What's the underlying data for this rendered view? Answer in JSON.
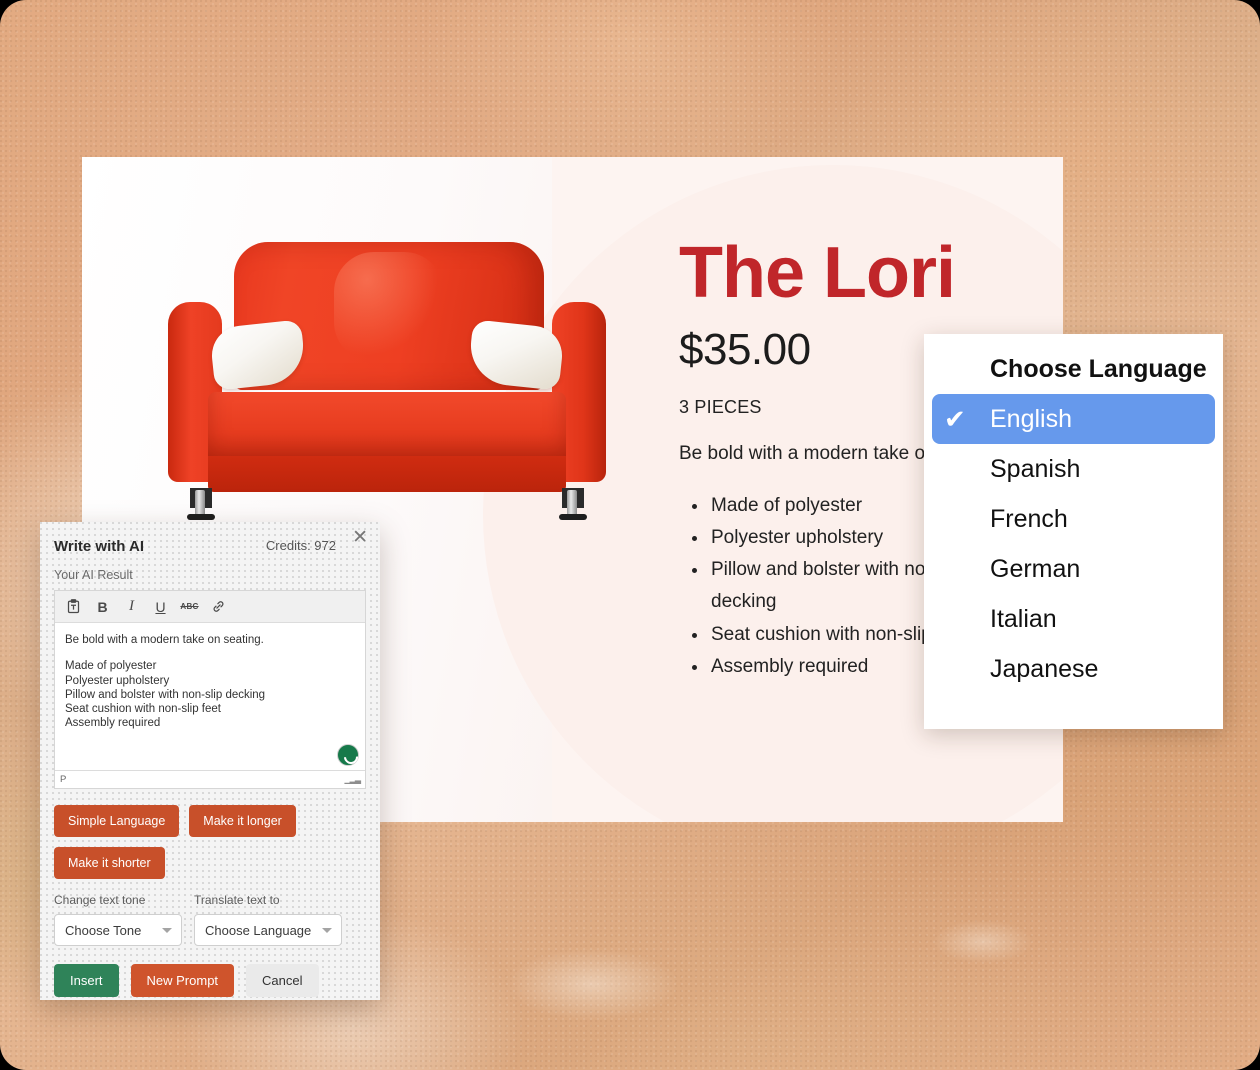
{
  "product": {
    "title": "The Lori",
    "price": "$35.00",
    "pieces": "3 PIECES",
    "description": "Be bold with a modern take on seating.",
    "features": [
      "Made of polyester",
      "Polyester upholstery",
      "Pillow and bolster with non-slip decking",
      "Seat cushion with non-slip feet",
      "Assembly required"
    ],
    "title_color": "#c0262a"
  },
  "language_dropdown": {
    "header": "Choose Language",
    "selected": "English",
    "check_glyph": "✔",
    "highlight_color": "#6699ec",
    "options": [
      {
        "label": "Choose Language",
        "is_header": true,
        "selected": false
      },
      {
        "label": "English",
        "is_header": false,
        "selected": true
      },
      {
        "label": "Spanish",
        "is_header": false,
        "selected": false
      },
      {
        "label": "French",
        "is_header": false,
        "selected": false
      },
      {
        "label": "German",
        "is_header": false,
        "selected": false
      },
      {
        "label": "Italian",
        "is_header": false,
        "selected": false
      },
      {
        "label": "Japanese",
        "is_header": false,
        "selected": false
      }
    ]
  },
  "ai_panel": {
    "title": "Write with AI",
    "credits": "Credits: 972",
    "close_glyph": "✕",
    "result_label": "Your AI Result",
    "toolbar": [
      {
        "name": "paste-plain-text-icon",
        "glyph": "📋"
      },
      {
        "name": "bold-icon",
        "glyph": "B"
      },
      {
        "name": "italic-icon",
        "glyph": "I"
      },
      {
        "name": "underline-icon",
        "glyph": "U"
      },
      {
        "name": "strikethrough-icon",
        "glyph": "ABC"
      },
      {
        "name": "link-icon",
        "glyph": "🔗"
      }
    ],
    "editor": {
      "paragraph": "Be bold with a modern take on seating.",
      "lines": [
        "Made of polyester",
        "Polyester upholstery",
        "Pillow and bolster with non-slip decking",
        "Seat cushion with non-slip feet",
        "Assembly required"
      ],
      "status_tag": "P"
    },
    "pills": [
      "Simple Language",
      "Make it longer",
      "Make it shorter"
    ],
    "tone_select": {
      "label": "Change text tone",
      "value": "Choose Tone"
    },
    "language_select": {
      "label": "Translate text to",
      "value": "Choose Language"
    },
    "actions": {
      "insert": "Insert",
      "new_prompt": "New Prompt",
      "cancel": "Cancel"
    },
    "colors": {
      "pill": "#c8502a",
      "insert": "#2f8359",
      "new_prompt": "#cf542c",
      "cancel": "#eaeaea"
    }
  }
}
